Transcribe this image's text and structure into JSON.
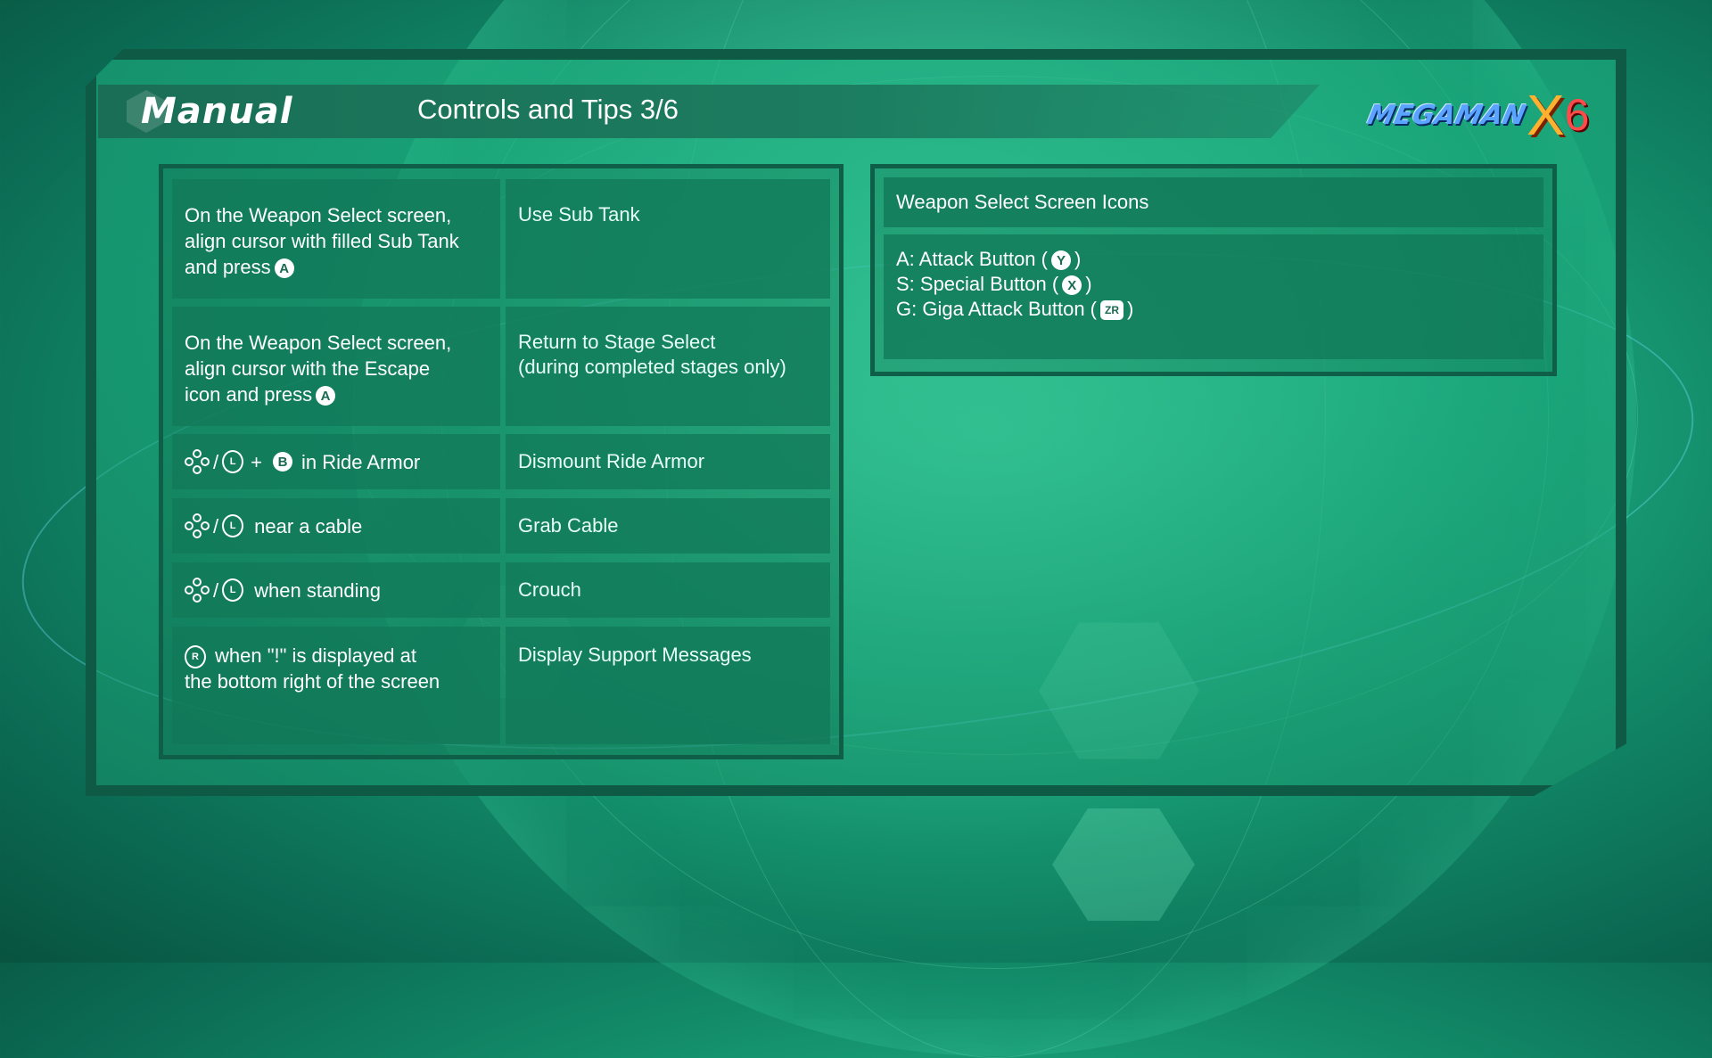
{
  "header": {
    "manual_label": "Manual",
    "page_title": "Controls and Tips 3/6"
  },
  "logo": {
    "text": "MEGAMAN",
    "x": "X",
    "six": "6"
  },
  "controls": [
    {
      "action_parts": [
        "On the Weapon Select screen,",
        "align cursor with filled Sub Tank",
        "and press"
      ],
      "button": "A",
      "result": "Use Sub Tank"
    },
    {
      "action_parts": [
        "On the Weapon Select screen,",
        "align cursor with the Escape",
        "icon and press"
      ],
      "button": "A",
      "result_lines": [
        "Return to Stage Select",
        "(during completed stages only)"
      ]
    },
    {
      "sep": "/",
      "plus": "+",
      "button": "B",
      "stick": "L",
      "action": "in Ride Armor",
      "result": "Dismount Ride Armor"
    },
    {
      "sep": "/",
      "stick": "L",
      "action": "near a cable",
      "result": "Grab Cable"
    },
    {
      "sep": "/",
      "stick": "L",
      "action": "when standing",
      "result": "Crouch"
    },
    {
      "stick": "R",
      "action_parts": [
        "when \"!\" is displayed at",
        "the bottom right of the screen"
      ],
      "result": "Display Support Messages"
    }
  ],
  "weapon_icons": {
    "title": "Weapon Select Screen Icons",
    "items": [
      {
        "label": "A: Attack Button (",
        "button": "Y",
        "close": ")"
      },
      {
        "label": "S: Special Button (",
        "button": "X",
        "close": ")"
      },
      {
        "label": "G: Giga Attack Button (",
        "button": "ZR",
        "close": ")"
      }
    ]
  },
  "colors": {
    "background": "#1fae82",
    "panel_border": "#0f5e47",
    "cell": "#12785a",
    "text": "#ffffff"
  }
}
